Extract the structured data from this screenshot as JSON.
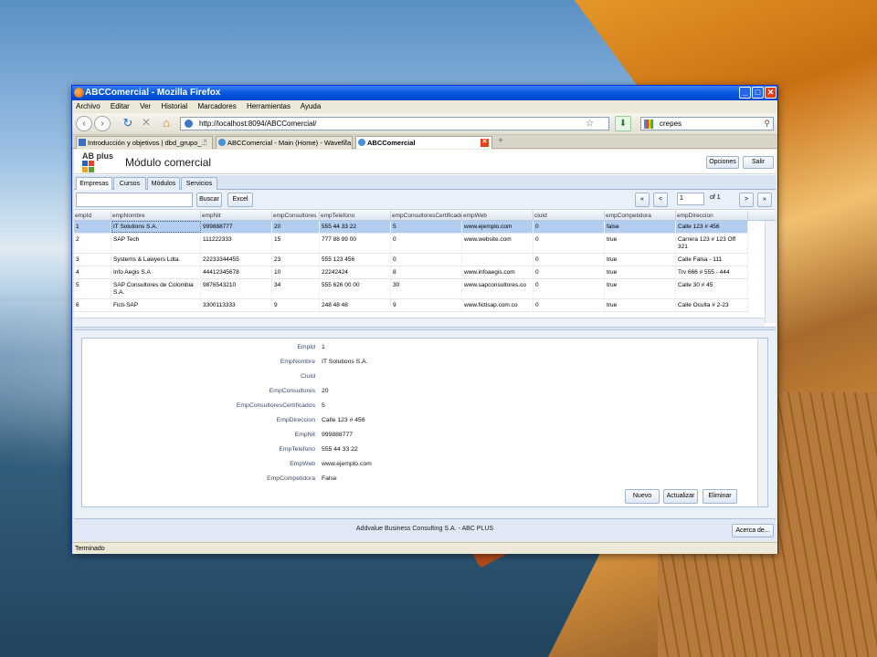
{
  "window": {
    "title": "ABCComercial - Mozilla Firefox",
    "min": "_",
    "max": "□",
    "close": "✕"
  },
  "menu": [
    "Archivo",
    "Editar",
    "Ver",
    "Historial",
    "Marcadores",
    "Herramientas",
    "Ayuda"
  ],
  "nav": {
    "back": "‹",
    "forward": "›",
    "reload": "↻",
    "stop": "✕",
    "home": "⌂",
    "url": "http://localhost:8094/ABCComercial/",
    "search": "crepes"
  },
  "browser_tabs": [
    {
      "label": "Introducción y objetivos | dbd_grupo_..."
    },
    {
      "label": "ABCComercial - Main (Home) - WaveMa..."
    },
    {
      "label": "ABCComercial"
    }
  ],
  "app": {
    "logo_text": "AB plus",
    "title": "Módulo comercial",
    "opciones": "Opciones",
    "salir": "Salir",
    "tabs": [
      "Empresas",
      "Cursos",
      "Módulos",
      "Servicios"
    ],
    "buscar": "Buscar",
    "excel": "Excel",
    "pager": {
      "first": "«",
      "prev": "<",
      "page": "1",
      "of": "of 1",
      "next": ">",
      "last": "»"
    }
  },
  "grid": {
    "columns": [
      "empId",
      "empNombre",
      "empNit",
      "empConsultores",
      "empTelefono",
      "empConsultoresCertificados",
      "empWeb",
      "ciuId",
      "empCompetidora",
      "empDireccion"
    ],
    "rows": [
      [
        "1",
        "IT Solutions S.A.",
        "999888777",
        "20",
        "555 44 33 22",
        "5",
        "www.ejemplo.com",
        "0",
        "false",
        "Calle 123 # 456"
      ],
      [
        "2",
        "SAP Tech",
        "111222333",
        "15",
        "777 88 99 00",
        "0",
        "www.website.com",
        "0",
        "true",
        "Carrera 123 # 123 Off 321"
      ],
      [
        "3",
        "Systems & Lawyers Ldta.",
        "22233344455",
        "23",
        "555 123 456",
        "0",
        "",
        "0",
        "true",
        "Calle Falsa - 111"
      ],
      [
        "4",
        "Info Aegis S.A",
        "44412345678",
        "10",
        "22242424",
        "8",
        "www.infoaegis.com",
        "0",
        "true",
        "Trv 666 # 555 - 444"
      ],
      [
        "5",
        "SAP Consultores de Colombia S.A.",
        "9876543210",
        "34",
        "555 626 00 00",
        "30",
        "www.sapconsultores.co",
        "0",
        "true",
        "Calle 30 # 45"
      ],
      [
        "6",
        "Ficti-SAP",
        "3300113333",
        "9",
        "248 48 48",
        "9",
        "www.fictisap.com.co",
        "0",
        "true",
        "Calle Oculta # 2-23"
      ]
    ]
  },
  "detail": {
    "fields": [
      {
        "label": "EmpId",
        "value": "1"
      },
      {
        "label": "EmpNombre",
        "value": "IT Solutions S.A."
      },
      {
        "label": "CiuId",
        "value": ""
      },
      {
        "label": "EmpConsultores",
        "value": "20"
      },
      {
        "label": "EmpConsultoresCertificados",
        "value": "5"
      },
      {
        "label": "EmpDireccion",
        "value": "Calle 123 # 456"
      },
      {
        "label": "EmpNit",
        "value": "999888777"
      },
      {
        "label": "EmpTelefono",
        "value": "555 44 33 22"
      },
      {
        "label": "EmpWeb",
        "value": "www.ejemplo.com"
      },
      {
        "label": "EmpCompetidora",
        "value": "False"
      }
    ],
    "nuevo": "Nuevo",
    "actualizar": "Actualizar",
    "eliminar": "Eliminar"
  },
  "footer": {
    "text": "Addvalue Business Consulting S.A. - ABC PLUS",
    "acerca": "Acerca de..."
  },
  "status": "Terminado"
}
